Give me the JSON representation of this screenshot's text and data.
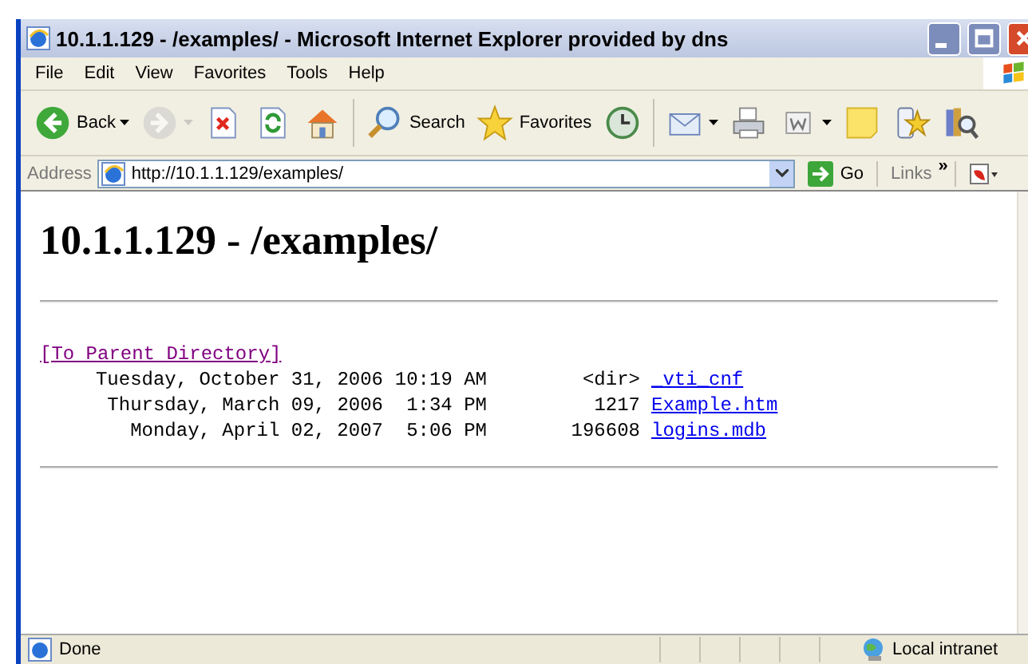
{
  "window": {
    "title": "10.1.1.129 - /examples/ - Microsoft Internet Explorer provided by dns"
  },
  "menu": [
    "File",
    "Edit",
    "View",
    "Favorites",
    "Tools",
    "Help"
  ],
  "toolbar": [
    {
      "kind": "back",
      "label": "Back",
      "dropdown": true,
      "disabled": false
    },
    {
      "kind": "forward",
      "dropdown": true,
      "disabled": true
    },
    {
      "kind": "stop",
      "disabled": false
    },
    {
      "kind": "refresh",
      "disabled": false
    },
    {
      "kind": "home",
      "disabled": false
    },
    {
      "kind": "separator"
    },
    {
      "kind": "search",
      "label": "Search",
      "disabled": false
    },
    {
      "kind": "favorites",
      "label": "Favorites",
      "disabled": false
    },
    {
      "kind": "history",
      "disabled": false
    },
    {
      "kind": "separator"
    },
    {
      "kind": "mail",
      "dropdown": true,
      "disabled": false
    },
    {
      "kind": "print",
      "disabled": false
    },
    {
      "kind": "edit",
      "dropdown": true,
      "disabled": false
    },
    {
      "kind": "note",
      "disabled": false
    },
    {
      "kind": "messenger",
      "disabled": false
    },
    {
      "kind": "research",
      "disabled": false
    }
  ],
  "address_bar": {
    "label": "Address",
    "url": "http://10.1.1.129/examples/",
    "go": "Go",
    "links": "Links",
    "more": "»"
  },
  "page": {
    "heading": "10.1.1.129 - /examples/",
    "parent_link": "[To Parent Directory]",
    "rows": [
      {
        "date": "Tuesday, October 31, 2006",
        "time": "10:19 AM",
        "size": "<dir>",
        "name": "_vti_cnf"
      },
      {
        "date": "Thursday, March 09, 2006",
        "time": "1:34 PM",
        "size": "1217",
        "name": "Example.htm"
      },
      {
        "date": "Monday, April 02, 2007",
        "time": "5:06 PM",
        "size": "196608",
        "name": "logins.mdb"
      }
    ]
  },
  "status_bar": {
    "text": "Done",
    "zone": "Local intranet"
  }
}
